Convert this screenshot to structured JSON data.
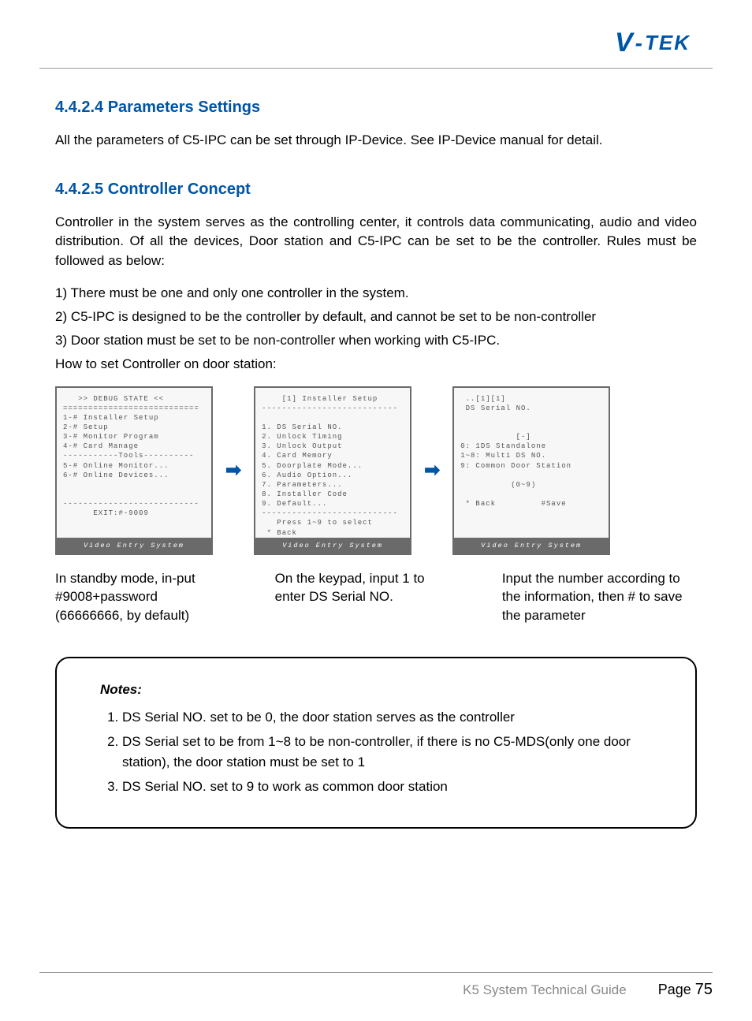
{
  "logo": {
    "v": "V",
    "hyphen": "-",
    "rest": "TEK"
  },
  "sections": {
    "s1": {
      "heading": "4.4.2.4 Parameters Settings",
      "body": "All the parameters of C5-IPC can be set through IP-Device. See IP-Device manual for detail."
    },
    "s2": {
      "heading": "4.4.2.5 Controller Concept",
      "intro": "Controller in the system serves as the controlling center, it controls data communicating, audio and video distribution. Of all the devices, Door station and C5-IPC can be set to be the controller. Rules must be followed as below:",
      "rules": [
        "1) There must be one and only one controller in the system.",
        "2) C5-IPC is designed to be the controller by default, and cannot be set to be non-controller",
        "3) Door station must be set to be non-controller when working with C5-IPC."
      ],
      "howto": "How to set Controller on door station:"
    }
  },
  "screens": {
    "footer": "Video Entry System",
    "s1": "   >> DEBUG STATE <<\n===========================\n1-# Installer Setup\n2-# Setup\n3-# Monitor Program\n4-# Card Manage\n-----------Tools----------\n5-# Online Monitor...\n6-# Online Devices...\n\n\n---------------------------\n      EXIT:#-9009",
    "s2": "    [1] Installer Setup\n---------------------------\n\n1. DS Serial NO.\n2. Unlock Timing\n3. Unlock Output\n4. Card Memory\n5. Doorplate Mode...\n6. Audio Option...\n7. Parameters...\n8. Installer Code\n9. Default...\n---------------------------\n   Press 1~9 to select\n * Back",
    "s3": " ..[1][1]\n DS Serial NO.\n\n\n           [-]\n0: 1DS Standalone\n1~8: Multi DS NO.\n9: Common Door Station\n\n          (0~9)\n\n * Back         #Save"
  },
  "captions": {
    "c1": "In standby mode, in-put #9008+password (66666666, by default)",
    "c2": "On the keypad, input 1 to enter DS Serial NO.",
    "c3": "Input the number according to the information, then # to save the parameter"
  },
  "notes": {
    "title": "Notes:",
    "items": [
      "DS Serial NO. set to be 0, the door station serves as the controller",
      "DS Serial set to be from 1~8 to be non-controller, if there is no C5-MDS(only one door station), the door station must be set to 1",
      "DS Serial NO. set to 9 to work as common door station"
    ]
  },
  "footer": {
    "guide": "K5 System Technical Guide",
    "pageLabel": "Page ",
    "pageNum": "75"
  }
}
